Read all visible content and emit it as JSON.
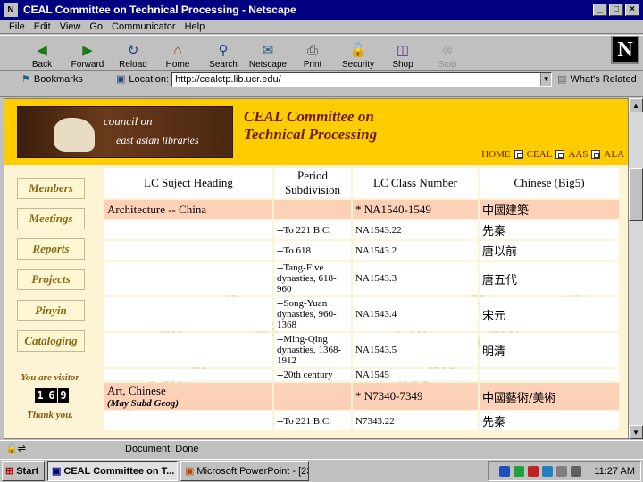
{
  "window": {
    "title": "CEAL Committee on Technical Processing - Netscape",
    "controls": [
      "_",
      "□",
      "×"
    ]
  },
  "menu": [
    "File",
    "Edit",
    "View",
    "Go",
    "Communicator",
    "Help"
  ],
  "toolbar": [
    {
      "label": "Back",
      "icon": "back-arrow-icon"
    },
    {
      "label": "Forward",
      "icon": "forward-arrow-icon"
    },
    {
      "label": "Reload",
      "icon": "reload-icon"
    },
    {
      "label": "Home",
      "icon": "home-icon"
    },
    {
      "label": "Search",
      "icon": "search-icon"
    },
    {
      "label": "Netscape",
      "icon": "netscape-icon"
    },
    {
      "label": "Print",
      "icon": "print-icon"
    },
    {
      "label": "Security",
      "icon": "lock-icon"
    },
    {
      "label": "Shop",
      "icon": "shop-icon"
    },
    {
      "label": "Stop",
      "icon": "stop-icon",
      "disabled": true
    }
  ],
  "location": {
    "bookmarks": "Bookmarks",
    "label": "Location:",
    "url": "http://cealctp.lib.ucr.edu/",
    "related": "What's Related"
  },
  "banner": {
    "img_line1": "council on",
    "img_line2": "east asian libraries",
    "title_line1": "CEAL Committee on",
    "title_line2": "Technical Processing"
  },
  "topnav": [
    "HOME",
    "CEAL",
    "AAS",
    "ALA"
  ],
  "sidebar": [
    "Members",
    "Meetings",
    "Reports",
    "Projects",
    "Pinyin",
    "Cataloging"
  ],
  "visitor": {
    "label": "You are visitor",
    "count": [
      "1",
      "6",
      "9"
    ],
    "thanks": "Thank you."
  },
  "watermark": {
    "line1": "Committee on",
    "line2": "Technical Processing"
  },
  "table": {
    "headers": [
      "LC Suject Heading",
      "Period Subdivision",
      "LC Class Number",
      "Chinese (Big5)"
    ],
    "rows": [
      {
        "heading": "Architecture -- China",
        "sub": "",
        "period": "",
        "class": "* NA1540-1549",
        "chinese": "中國建築",
        "main": true
      },
      {
        "heading": "",
        "sub": "",
        "period": "--To 221 B.C.",
        "class": "NA1543.22",
        "chinese": "先秦",
        "main": false
      },
      {
        "heading": "",
        "sub": "",
        "period": "--To 618",
        "class": "NA1543.2",
        "chinese": "唐以前",
        "main": false
      },
      {
        "heading": "",
        "sub": "",
        "period": "--Tang-Five dynasties, 618-960",
        "class": "NA1543.3",
        "chinese": "唐五代",
        "main": false
      },
      {
        "heading": "",
        "sub": "",
        "period": "--Song-Yuan dynasties, 960-1368",
        "class": "NA1543.4",
        "chinese": "宋元",
        "main": false
      },
      {
        "heading": "",
        "sub": "",
        "period": "--Ming-Qing dynasties, 1368-1912",
        "class": "NA1543.5",
        "chinese": "明清",
        "main": false
      },
      {
        "heading": "",
        "sub": "",
        "period": "--20th century",
        "class": "NA1545",
        "chinese": "",
        "main": false
      },
      {
        "heading": "Art, Chinese",
        "sub": "(May Subd Geog)",
        "period": "",
        "class": "* N7340-7349",
        "chinese": "中國藝術/美術",
        "main": true
      },
      {
        "heading": "",
        "sub": "",
        "period": "--To 221 B.C.",
        "class": "N7343.22",
        "chinese": "先秦",
        "main": false
      }
    ]
  },
  "status": {
    "text": "Document: Done"
  },
  "taskbar": {
    "start": "Start",
    "tasks": [
      "CEAL Committee on T...",
      "Microsoft PowerPoint - [23..."
    ],
    "clock": "11:27 AM"
  }
}
